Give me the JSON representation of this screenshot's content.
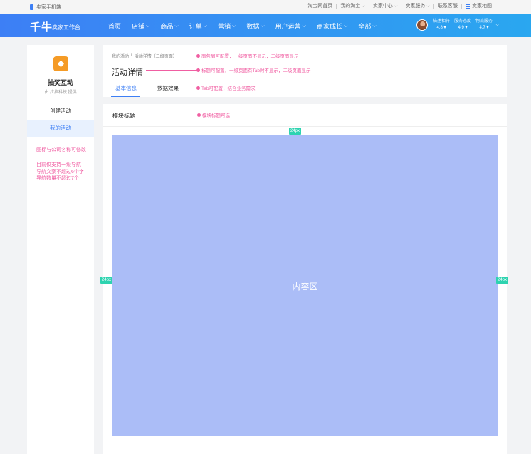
{
  "topbar": {
    "mobile_label": "卖家手机端",
    "links": [
      {
        "label": "淘宝网首页",
        "dropdown": false
      },
      {
        "label": "我的淘宝",
        "dropdown": true
      },
      {
        "label": "卖家中心",
        "dropdown": true
      },
      {
        "label": "卖家服务",
        "dropdown": true
      },
      {
        "label": "联系客服",
        "dropdown": false
      },
      {
        "label": "卖家地图",
        "dropdown": false
      }
    ]
  },
  "header": {
    "logo": "千牛",
    "logo_sub": "卖家工作台",
    "nav": [
      {
        "label": "首页",
        "dropdown": false
      },
      {
        "label": "店铺",
        "dropdown": true
      },
      {
        "label": "商品",
        "dropdown": true
      },
      {
        "label": "订单",
        "dropdown": true
      },
      {
        "label": "营销",
        "dropdown": true
      },
      {
        "label": "数据",
        "dropdown": true
      },
      {
        "label": "用户运营",
        "dropdown": true
      },
      {
        "label": "商家成长",
        "dropdown": true
      },
      {
        "label": "全部",
        "dropdown": true
      }
    ],
    "ratings": [
      {
        "label": "描述相符",
        "value": "4.8"
      },
      {
        "label": "服务态度",
        "value": "4.9"
      },
      {
        "label": "物流服务",
        "value": "4.7"
      }
    ]
  },
  "sidebar": {
    "app_name": "抽奖互动",
    "provider": "由 拉拉科技 提供",
    "items": [
      {
        "label": "创建活动",
        "active": false
      },
      {
        "label": "我的活动",
        "active": true
      }
    ],
    "note1": "图标与公司名称可修改",
    "note2_lines": [
      "目前仅支持一级导航",
      "导航文案不超过6个字",
      "导航数量不超过7个"
    ]
  },
  "page": {
    "breadcrumb": [
      "我的活动",
      "活动详情（二级页面）"
    ],
    "title": "活动详情",
    "tabs": [
      {
        "label": "基本信息",
        "active": true
      },
      {
        "label": "数据效果",
        "active": false
      }
    ]
  },
  "module": {
    "title": "模块标题",
    "content_label": "内容区",
    "spacing_label": "24px"
  },
  "annotations": {
    "breadcrumb": "面包屑可配置，一级页面不显示，二级页面显示",
    "title": "标题可配置，一级页面有Tab时不显示，二级页面显示",
    "tabs": "Tab可配置，结合业务需求",
    "module": "模块标题可选"
  },
  "colors": {
    "brand_blue": "#3d7ff5",
    "annotation_pink": "#f05ea2",
    "content_blue": "#abbdf7",
    "spacing_green": "#2ed3b0",
    "app_icon_orange": "#f59b26"
  }
}
